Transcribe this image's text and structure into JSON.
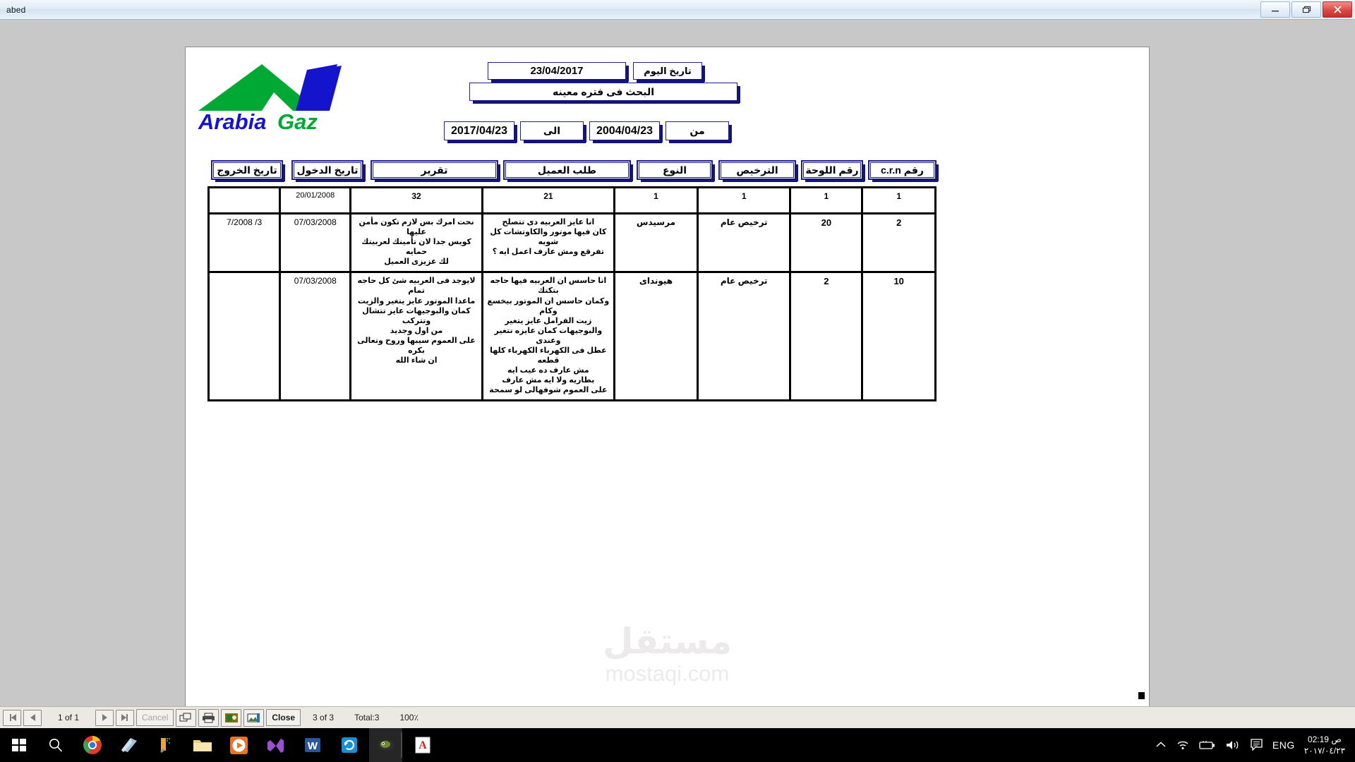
{
  "window": {
    "title": "abed",
    "minimize_label": "minimize",
    "restore_label": "restore",
    "close_label": "close"
  },
  "report": {
    "logo_text": "ArabiaGaz",
    "logo_colors": {
      "green": "#00a933",
      "blue": "#1414cc"
    },
    "today_label": "تاريخ اليوم",
    "today_value": "23/04/2017",
    "search_title": "البحث فى فتره معينه",
    "from_label": "من",
    "from_value": "2004/04/23",
    "to_label": "الى",
    "to_value": "2017/04/23",
    "accent_color": "#151577",
    "columns": [
      {
        "key": "crn",
        "label": "رقم c.r.n"
      },
      {
        "key": "plate",
        "label": "رقم اللوحة"
      },
      {
        "key": "lic",
        "label": "الترخيص"
      },
      {
        "key": "type",
        "label": "النوع"
      },
      {
        "key": "req",
        "label": "طلب العميل"
      },
      {
        "key": "rep",
        "label": "تقرير"
      },
      {
        "key": "in",
        "label": "تاريخ الدخول"
      },
      {
        "key": "out",
        "label": "تاريخ الخروج"
      }
    ],
    "rows": [
      {
        "crn": "1",
        "plate": "1",
        "lic": "1",
        "type": "1",
        "req": "21",
        "rep": "32",
        "in": "20/01/2008",
        "out": ""
      },
      {
        "crn": "2",
        "plate": "20",
        "lic": "ترخيص عام",
        "type": "مرسيدس",
        "req": "انا عايز العربيه دى تتصلح\nكان فيها موتور والكاوتشات كل شويه\nتفرقع ومش عارف اعمل ايه ؟",
        "rep": "نحت امرك بس لازم تكون مأمن عليها\nكويس جدا لان تأمينك لعربيتك حمايه\nلك عزيزى العميل",
        "in": "07/03/2008",
        "out": "3/ 7/2008"
      },
      {
        "crn": "10",
        "plate": "2",
        "lic": "ترخيص عام",
        "type": "هيونداى",
        "req": "انا حاسس ان العربيه فيها حاجه بتكتك\nوكمان حاسس ان الموتور بيخسع وكام\nزيت الفرامل عايز يتغير\nوالبوجيهات كمان عايزه تتغير وعندى\nعطل فى الكهرباء الكهرباء كلها قطعه\nمش عارف ده عيب ايه\nبطاريه ولا ايه مش عارف\nعلى العموم شوفهالى لو سمحة",
        "rep": "لايوجد فى العربيه شئ كل حاجه تمام\nماعدا الموتور عايز يتغير والزيت\nكمان والبوجيهات عايز تتشال وتتركب\nمن اول وجديد\nعلى العموم سيبها وروح وتعالى بكره\nان شاء الله",
        "in": "07/03/2008",
        "out": ""
      }
    ]
  },
  "watermark": {
    "arabic": "مستقل",
    "latin": "mostaqi.com"
  },
  "preview_toolbar": {
    "first_label": "first-page",
    "prev_label": "previous-page",
    "page_of": "1 of 1",
    "next_label": "next-page",
    "last_label": "last-page",
    "cancel_label": "Cancel",
    "export_label": "export",
    "print_label": "print",
    "setup_label": "page-setup",
    "image_label": "export-image",
    "close_label": "Close",
    "record_of": "3 of 3",
    "total": "Total:3",
    "zoom": "100٪"
  },
  "taskbar": {
    "apps": [
      {
        "name": "start"
      },
      {
        "name": "search"
      },
      {
        "name": "chrome"
      },
      {
        "name": "file-explorer-blue"
      },
      {
        "name": "tools"
      },
      {
        "name": "folder"
      },
      {
        "name": "media-player"
      },
      {
        "name": "visual-studio"
      },
      {
        "name": "word"
      },
      {
        "name": "sync"
      },
      {
        "name": "access"
      },
      {
        "name": "pdf"
      }
    ],
    "tray": {
      "language": "ENG",
      "time": "02:19 ص",
      "date": "٢٠١٧/٠٤/٢٣"
    }
  }
}
